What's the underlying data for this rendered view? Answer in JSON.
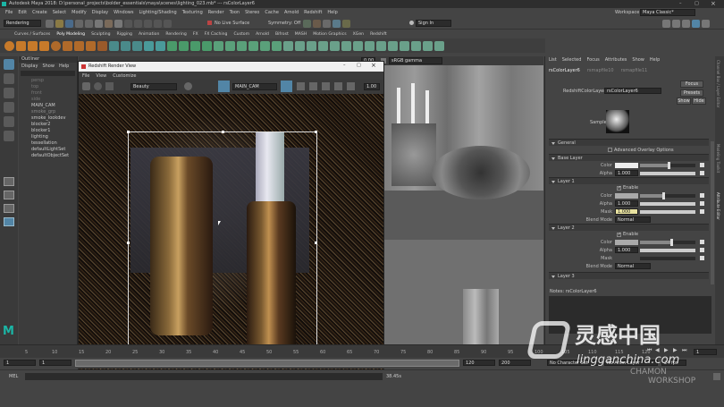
{
  "title_bar": {
    "text": "Autodesk Maya 2018: D:\\personal_projects\\bolder_essentials\\maya\\scenes\\lighting_023.mb* --- rsColorLayer6"
  },
  "menu_bar": {
    "items": [
      "File",
      "Edit",
      "Create",
      "Select",
      "Modify",
      "Display",
      "Windows",
      "Lighting/Shading",
      "Texturing",
      "Render",
      "Toon",
      "Stereo",
      "Cache",
      "Arnold",
      "Redshift",
      "Help"
    ],
    "workspace_label": "Workspace :",
    "workspace_value": "Maya Classic*"
  },
  "status_line": {
    "mode": "Rendering",
    "live_surface": "No Live Surface",
    "symmetry": "Symmetry: Off",
    "sign_in": "Sign In"
  },
  "shelf_tabs": [
    "Curves / Surfaces",
    "Poly Modeling",
    "Sculpting",
    "Rigging",
    "Animation",
    "Rendering",
    "FX",
    "FX Caching",
    "Custom",
    "Arnold",
    "Bifrost",
    "MASH",
    "Motion Graphics",
    "XGen",
    "Redshift"
  ],
  "outliner": {
    "title": "Outliner",
    "menu": [
      "Display",
      "Show",
      "Help"
    ],
    "items": [
      "persp",
      "top",
      "front",
      "side",
      "MAIN_CAM",
      "smoke_grp",
      "smoke_lookdev",
      "blocker2",
      "blocker1",
      "lighting",
      "tessellation",
      "defaultLightSet",
      "defaultObjectSet"
    ]
  },
  "render_view": {
    "title": "Redshift Render View",
    "menu": [
      "File",
      "View",
      "Customize"
    ],
    "aov": "Beauty",
    "camera": "MAIN_CAM",
    "colorspace": "sRGB gamma",
    "exposure": "1.00"
  },
  "viewport": {
    "exposure": "0.00"
  },
  "attribute_editor": {
    "tabs": [
      "List",
      "Selected",
      "Focus",
      "Attributes",
      "Show",
      "Help"
    ],
    "node_tabs": [
      "rsColorLayer6",
      "rsmapfile10",
      "rsmapfile11"
    ],
    "node_label": "RedshiftColorLayer:",
    "node_name": "rsColorLayer6",
    "buttons": {
      "focus": "Focus",
      "presets": "Presets",
      "show": "Show",
      "hide": "Hide"
    },
    "sample_label": "Sample",
    "general": "General",
    "advanced_overlay": "Advanced Overlay Options",
    "base_layer": "Base Layer",
    "color_label": "Color",
    "alpha_label": "Alpha",
    "mask_label": "Mask",
    "blend_mode_label": "Blend Mode",
    "enable_label": "Enable",
    "base_alpha": "1.000",
    "layer1": {
      "title": "Layer 1",
      "alpha": "1.000",
      "mask": "1.000",
      "blend": "Normal"
    },
    "layer2": {
      "title": "Layer 2",
      "alpha": "1.000",
      "mask": "",
      "blend": "Normal"
    },
    "layer3": {
      "title": "Layer 3"
    },
    "notes": "Notes: rsColorLayer6"
  },
  "side_tabs": [
    "Channel Box / Layer Editor",
    "Modeling Toolkit",
    "Attribute Editor"
  ],
  "timeline": {
    "ticks": [
      "5",
      "10",
      "15",
      "20",
      "25",
      "30",
      "35",
      "40",
      "45",
      "50",
      "55",
      "60",
      "65",
      "70",
      "75",
      "80",
      "85",
      "90",
      "95",
      "100",
      "105",
      "110",
      "115",
      "120"
    ],
    "start": "1",
    "current": "1",
    "range_start": "1",
    "range_end": "120",
    "end": "120",
    "max": "200",
    "character_set": "No Character Set",
    "anim_layer": "No Anim Layer",
    "fps": "24 fps"
  },
  "command_line": {
    "label": "MEL",
    "status": "38.45s"
  },
  "watermark": {
    "brand": "灵感中国",
    "url": "lingganchina.com",
    "sub": "CHAMON",
    "sub2": "WORKSHOP"
  },
  "colors": {
    "accent": "#5285a6",
    "menu_bg": "#444444",
    "panel": "#3c3c3c",
    "dark": "#2b2b2b",
    "maya_logo": "#1bb5a5"
  }
}
